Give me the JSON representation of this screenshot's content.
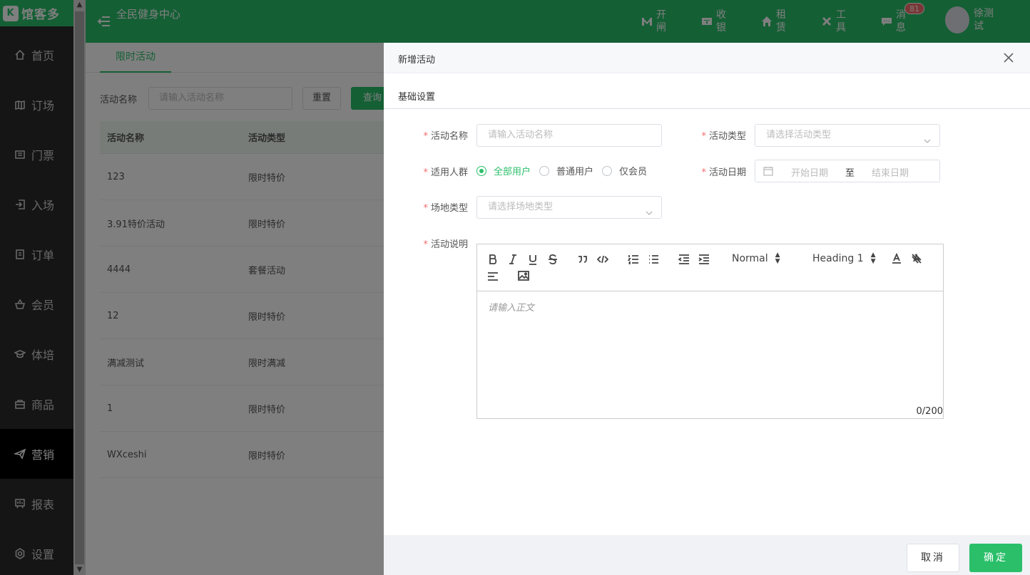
{
  "brand": {
    "logo_text": "馆客多",
    "logo_mark": "K"
  },
  "header": {
    "venue_name": "全民健身中心",
    "tools": [
      {
        "label": "开闸",
        "icon": "gate-icon"
      },
      {
        "label": "收银",
        "icon": "cashier-icon"
      },
      {
        "label": "租赁",
        "icon": "rental-icon"
      },
      {
        "label": "工具",
        "icon": "tools-icon"
      },
      {
        "label": "消息",
        "icon": "message-icon"
      }
    ],
    "message_badge": "81",
    "user_name": "徐测试"
  },
  "sidebar": {
    "items": [
      {
        "label": "首页",
        "icon": "home-icon"
      },
      {
        "label": "订场",
        "icon": "booking-icon"
      },
      {
        "label": "门票",
        "icon": "ticket-icon"
      },
      {
        "label": "入场",
        "icon": "entry-icon"
      },
      {
        "label": "订单",
        "icon": "order-icon"
      },
      {
        "label": "会员",
        "icon": "member-icon"
      },
      {
        "label": "体培",
        "icon": "training-icon"
      },
      {
        "label": "商品",
        "icon": "goods-icon"
      },
      {
        "label": "营销",
        "icon": "marketing-icon",
        "active": true
      },
      {
        "label": "报表",
        "icon": "report-icon"
      },
      {
        "label": "设置",
        "icon": "settings-icon"
      }
    ]
  },
  "page": {
    "tab": "限时活动",
    "filter": {
      "label": "活动名称",
      "placeholder": "请输入活动名称",
      "reset": "重置",
      "query": "查询"
    },
    "table": {
      "columns": [
        "活动名称",
        "活动类型"
      ],
      "rows": [
        [
          "123",
          "限时特价"
        ],
        [
          "3.91特价活动",
          "限时特价"
        ],
        [
          "4444",
          "套餐活动"
        ],
        [
          "12",
          "限时特价"
        ],
        [
          "满减测试",
          "限时满减"
        ],
        [
          "1",
          "限时特价"
        ],
        [
          "WXceshi",
          "限时特价"
        ]
      ]
    }
  },
  "drawer": {
    "title": "新增活动",
    "section": "基础设置",
    "form": {
      "name_label": "活动名称",
      "name_placeholder": "请输入活动名称",
      "type_label": "活动类型",
      "type_placeholder": "请选择活动类型",
      "audience_label": "适用人群",
      "audience_options": [
        "全部用户",
        "普通用户",
        "仅会员"
      ],
      "audience_selected": "全部用户",
      "date_label": "活动日期",
      "date_start": "开始日期",
      "date_sep": "至",
      "date_end": "结束日期",
      "venue_label": "场地类型",
      "venue_placeholder": "请选择场地类型",
      "desc_label": "活动说明",
      "editor": {
        "normal": "Normal",
        "heading": "Heading 1",
        "placeholder": "请输入正文",
        "counter": "0/200"
      }
    },
    "cancel": "取消",
    "confirm": "确定"
  },
  "colors": {
    "brand": "#2bbf6a",
    "sidebar": "#2b2b2b",
    "danger": "#f56c6c"
  }
}
